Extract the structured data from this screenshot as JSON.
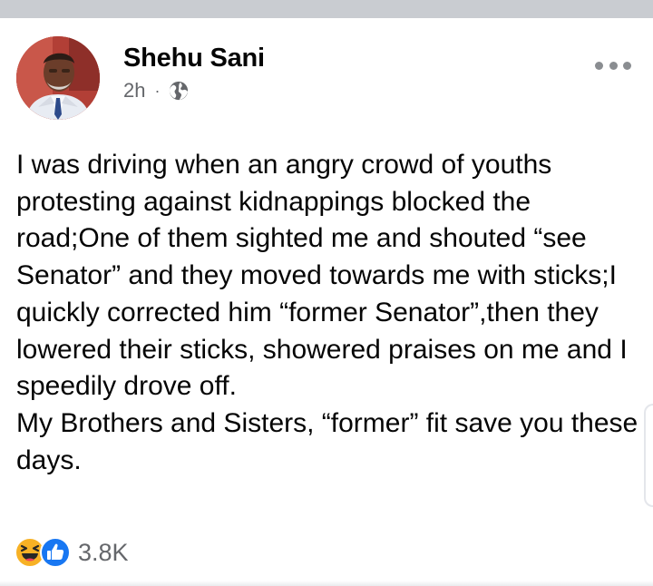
{
  "post": {
    "author": "Shehu Sani",
    "time": "2h",
    "separator": "·",
    "audience_icon": "globe-icon",
    "more_icon": "more-options-icon",
    "paragraphs": [
      "I was driving when an angry crowd of youths protesting against kidnappings blocked the road;One of them sighted me and shouted “see Senator” and they moved towards me with sticks;I quickly corrected him “former Senator”,then they lowered their sticks, showered praises on me and I speedily drove off.",
      "My Brothers and Sisters, “former” fit save you these days."
    ],
    "reactions": {
      "icons": [
        "haha-icon",
        "like-icon"
      ],
      "count": "3.8K"
    }
  },
  "colors": {
    "divider": "#c9ccd1",
    "secondary_text": "#65676b",
    "like_blue": "#1877f2",
    "haha_yellow": "#f7b125"
  }
}
